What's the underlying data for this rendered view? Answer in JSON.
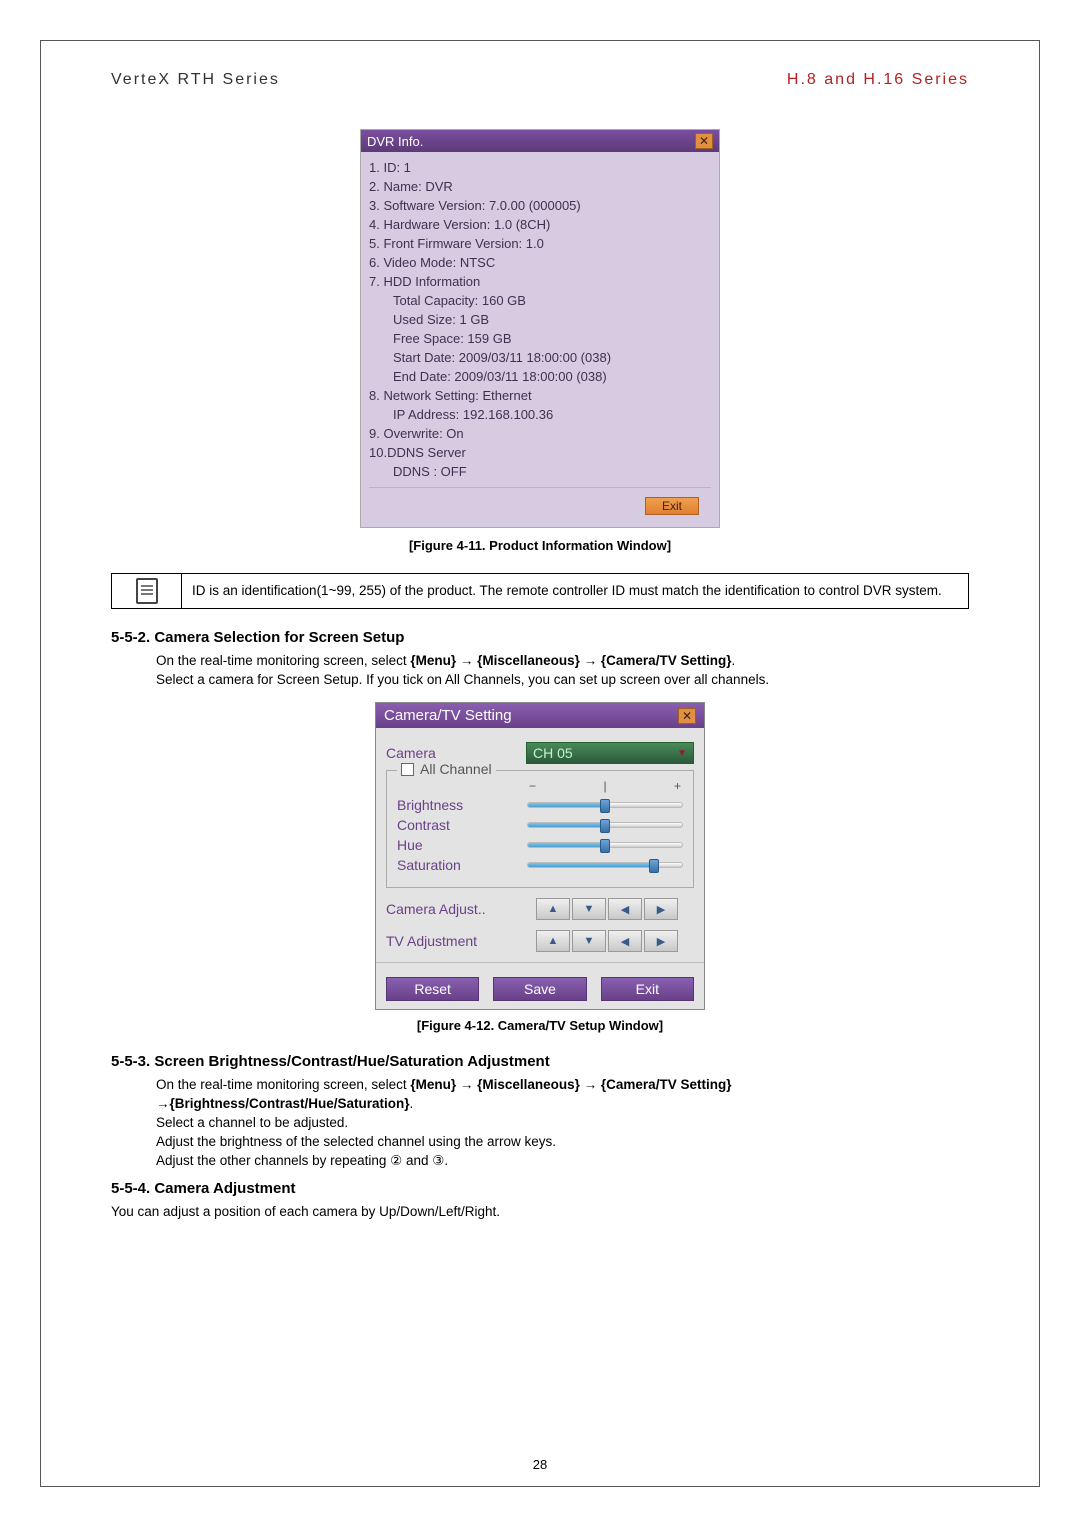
{
  "header": {
    "left": "VerteX RTH Series",
    "right": "H.8 and H.16 Series"
  },
  "dvr_window": {
    "title": "DVR Info.",
    "rows": {
      "r1": "1. ID: 1",
      "r2": "2. Name: DVR",
      "r3": "3. Software Version: 7.0.00 (000005)",
      "r4": "4. Hardware Version: 1.0 (8CH)",
      "r5": "5. Front Firmware Version: 1.0",
      "r6": "6. Video Mode: NTSC",
      "r7": "7. HDD Information",
      "r7a": "Total Capacity: 160 GB",
      "r7b": "Used Size: 1 GB",
      "r7c": "Free Space: 159 GB",
      "r7d": "Start Date: 2009/03/11 18:00:00 (038)",
      "r7e": "End Date: 2009/03/11 18:00:00 (038)",
      "r8": "8. Network Setting: Ethernet",
      "r8a": "IP Address: 192.168.100.36",
      "r9": "9. Overwrite: On",
      "r10": "10.DDNS Server",
      "r10a": "DDNS : OFF"
    },
    "exit": "Exit"
  },
  "fig1": "[Figure 4-11. Product Information Window]",
  "note": "ID is an identification(1~99, 255) of the product. The remote controller ID must match the identification to control DVR system.",
  "sec552_title": "5-5-2. Camera Selection for Screen Setup",
  "sec552_p1a": "On the real-time monitoring screen, select ",
  "sec552_p1b": "{Menu} → {Miscellaneous} → {Camera/TV Setting}",
  "sec552_p1c": ".",
  "sec552_p2": "Select a camera for Screen Setup. If you tick on All Channels, you can set up screen over all channels.",
  "cam_window": {
    "title": "Camera/TV Setting",
    "camera_label": "Camera",
    "camera_value": "CH 05",
    "all_channel": "All Channel",
    "scale": {
      "minus": "−",
      "mid": "|",
      "plus": "+"
    },
    "sliders": {
      "brightness": {
        "label": "Brightness",
        "pct": 50
      },
      "contrast": {
        "label": "Contrast",
        "pct": 50
      },
      "hue": {
        "label": "Hue",
        "pct": 50
      },
      "saturation": {
        "label": "Saturation",
        "pct": 82
      }
    },
    "camera_adjust": "Camera Adjust..",
    "tv_adjust": "TV Adjustment",
    "reset": "Reset",
    "save": "Save",
    "exit": "Exit"
  },
  "fig2": "[Figure 4-12. Camera/TV Setup Window]",
  "sec553_title": "5-5-3. Screen Brightness/Contrast/Hue/Saturation Adjustment",
  "sec553_l1a": "On the real-time monitoring screen, select ",
  "sec553_l1b": "{Menu} → {Miscellaneous} → {Camera/TV Setting}",
  "sec553_l2": "→{Brightness/Contrast/Hue/Saturation}",
  "sec553_l2b": ".",
  "sec553_l3": "Select a channel to be adjusted.",
  "sec553_l4": "Adjust the brightness of the selected channel using the arrow keys.",
  "sec553_l5": "Adjust the other channels by repeating ② and ③.",
  "sec554_title": "5-5-4. Camera Adjustment",
  "sec554_p": "You can adjust a position of each camera by Up/Down/Left/Right.",
  "page_num": "28"
}
